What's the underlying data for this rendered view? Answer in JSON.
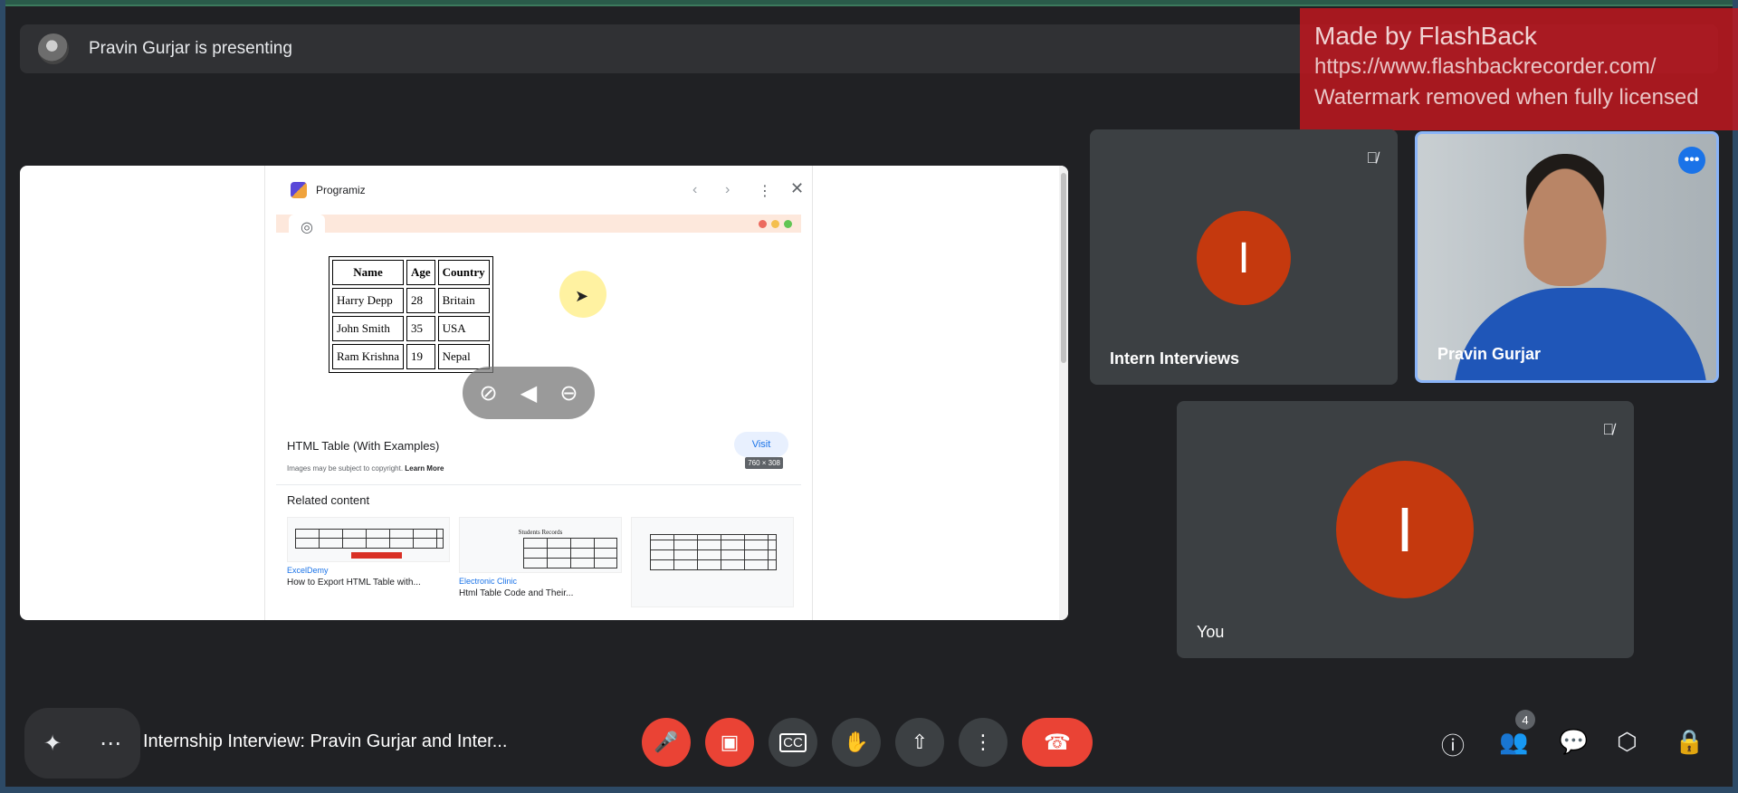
{
  "presenting_banner": {
    "text": "Pravin Gurjar is presenting"
  },
  "watermark": {
    "line1": "Made by FlashBack",
    "line2": "https://www.flashbackrecorder.com/",
    "line3": "Watermark removed when fully licensed"
  },
  "shared_screen": {
    "site_name": "Programiz",
    "preview_size": "760 × 308",
    "table": {
      "headers": [
        "Name",
        "Age",
        "Country"
      ],
      "rows": [
        [
          "Harry Depp",
          "28",
          "Britain"
        ],
        [
          "John Smith",
          "35",
          "USA"
        ],
        [
          "Ram Krishna",
          "19",
          "Nepal"
        ]
      ]
    },
    "result_title": "HTML Table (With Examples)",
    "visit_label": "Visit",
    "copyright_text": "Images may be subject to copyright.",
    "learn_more": "Learn More",
    "related_heading": "Related content",
    "related": [
      {
        "source": "ExcelDemy",
        "caption": "How to Export HTML Table with..."
      },
      {
        "source": "Electronic Clinic",
        "caption": "Html Table Code and Their...",
        "thumb_title": "Students Records"
      },
      {
        "source": "",
        "caption": ""
      }
    ]
  },
  "participants": [
    {
      "name": "Intern Interviews",
      "initial": "I",
      "muted": true
    },
    {
      "name": "Pravin Gurjar",
      "muted": false
    },
    {
      "name": "You",
      "initial": "I",
      "muted": true
    }
  ],
  "meeting": {
    "title": "Internship Interview: Pravin Gurjar and Inter...",
    "participant_count": "4"
  },
  "colors": {
    "background": "#202124",
    "tile": "#3c4043",
    "avatar": "#c5390e",
    "danger": "#ea4335",
    "highlight": "#8ab4f8"
  }
}
